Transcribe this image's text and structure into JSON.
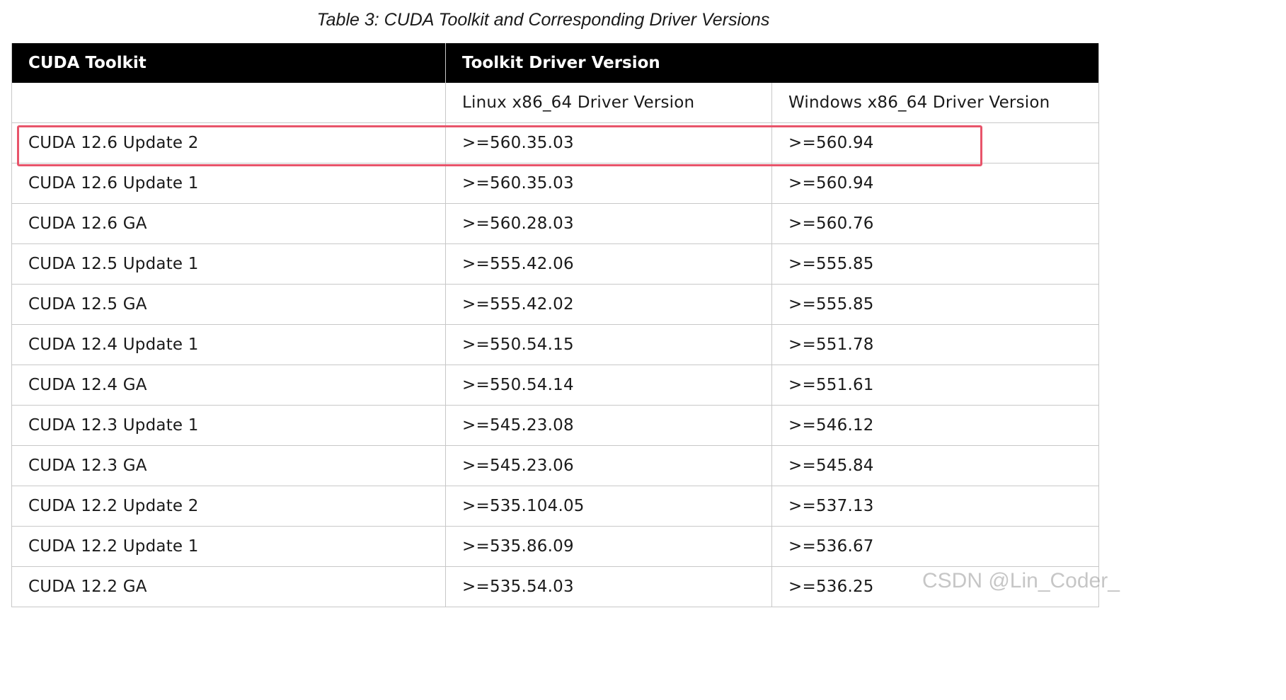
{
  "caption": "Table 3: CUDA Toolkit and Corresponding Driver Versions",
  "header": {
    "col1": "CUDA Toolkit",
    "col2": "Toolkit Driver Version"
  },
  "subheader": {
    "col1": "",
    "col2": "Linux x86_64 Driver Version",
    "col3": "Windows x86_64 Driver Version"
  },
  "rows": [
    {
      "toolkit": "CUDA 12.6 Update 2",
      "linux": ">=560.35.03",
      "windows": ">=560.94"
    },
    {
      "toolkit": "CUDA 12.6 Update 1",
      "linux": ">=560.35.03",
      "windows": ">=560.94"
    },
    {
      "toolkit": "CUDA 12.6 GA",
      "linux": ">=560.28.03",
      "windows": ">=560.76"
    },
    {
      "toolkit": "CUDA 12.5 Update 1",
      "linux": ">=555.42.06",
      "windows": ">=555.85"
    },
    {
      "toolkit": "CUDA 12.5 GA",
      "linux": ">=555.42.02",
      "windows": ">=555.85"
    },
    {
      "toolkit": "CUDA 12.4 Update 1",
      "linux": ">=550.54.15",
      "windows": ">=551.78"
    },
    {
      "toolkit": "CUDA 12.4 GA",
      "linux": ">=550.54.14",
      "windows": ">=551.61"
    },
    {
      "toolkit": "CUDA 12.3 Update 1",
      "linux": ">=545.23.08",
      "windows": ">=546.12"
    },
    {
      "toolkit": "CUDA 12.3 GA",
      "linux": ">=545.23.06",
      "windows": ">=545.84"
    },
    {
      "toolkit": "CUDA 12.2 Update 2",
      "linux": ">=535.104.05",
      "windows": ">=537.13"
    },
    {
      "toolkit": "CUDA 12.2 Update 1",
      "linux": ">=535.86.09",
      "windows": ">=536.67"
    },
    {
      "toolkit": "CUDA 12.2 GA",
      "linux": ">=535.54.03",
      "windows": ">=536.25"
    }
  ],
  "highlight": {
    "row": "CUDA 12.6 Update 2",
    "color": "#e8546a"
  },
  "watermark": "CSDN @Lin_Coder_"
}
